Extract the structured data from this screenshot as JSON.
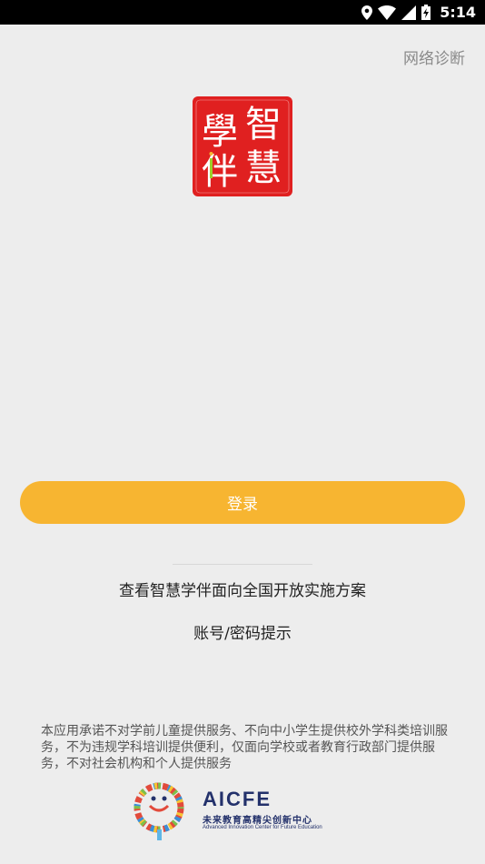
{
  "status_bar": {
    "time": "5:14",
    "icons": [
      "location-icon",
      "wifi-icon",
      "cellular-signal-icon",
      "battery-charging-icon"
    ]
  },
  "header": {
    "network_diagnosis": "网络诊断"
  },
  "logo": {
    "characters": [
      "智",
      "慧",
      "學",
      "伴"
    ],
    "color": "#e02020"
  },
  "login": {
    "label": "登录",
    "color": "#f7b531"
  },
  "links": {
    "plan": "查看智慧学伴面向全国开放实施方案",
    "account_hint": "账号/密码提示"
  },
  "notice": "本应用承诺不对学前儿童提供服务、不向中小学生提供校外学科类培训服务，不为违规学科培训提供便利，仅面向学校或者教育行政部门提供服务，不对社会机构和个人提供服务",
  "footer_logo": {
    "title": "AICFE",
    "subtitle_cn": "未来教育高精尖创新中心",
    "subtitle_en": "Advanced Innovation Center for Future Education"
  }
}
